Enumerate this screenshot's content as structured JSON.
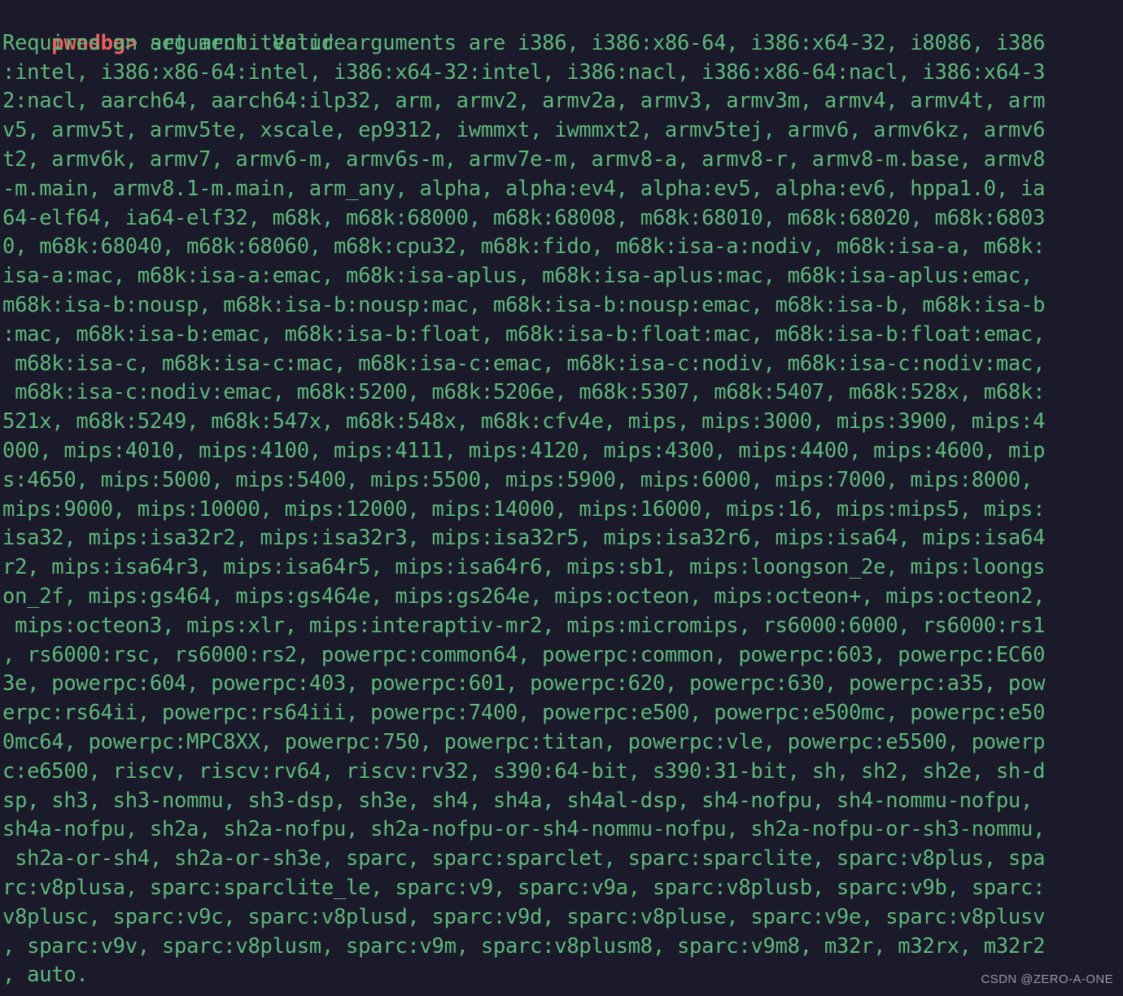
{
  "terminal": {
    "background_color": "#1a1a2b",
    "prompt_color": "#e8615c",
    "output_color": "#5fb87a",
    "prompt": "pwndbg>",
    "command": " set architecture",
    "output_lines": [
      "Requires an argument. Valid arguments are i386, i386:x86-64, i386:x64-32, i8086, i386",
      ":intel, i386:x86-64:intel, i386:x64-32:intel, i386:nacl, i386:x86-64:nacl, i386:x64-3",
      "2:nacl, aarch64, aarch64:ilp32, arm, armv2, armv2a, armv3, armv3m, armv4, armv4t, arm",
      "v5, armv5t, armv5te, xscale, ep9312, iwmmxt, iwmmxt2, armv5tej, armv6, armv6kz, armv6",
      "t2, armv6k, armv7, armv6-m, armv6s-m, armv7e-m, armv8-a, armv8-r, armv8-m.base, armv8",
      "-m.main, armv8.1-m.main, arm_any, alpha, alpha:ev4, alpha:ev5, alpha:ev6, hppa1.0, ia",
      "64-elf64, ia64-elf32, m68k, m68k:68000, m68k:68008, m68k:68010, m68k:68020, m68k:6803",
      "0, m68k:68040, m68k:68060, m68k:cpu32, m68k:fido, m68k:isa-a:nodiv, m68k:isa-a, m68k:",
      "isa-a:mac, m68k:isa-a:emac, m68k:isa-aplus, m68k:isa-aplus:mac, m68k:isa-aplus:emac,",
      "m68k:isa-b:nousp, m68k:isa-b:nousp:mac, m68k:isa-b:nousp:emac, m68k:isa-b, m68k:isa-b",
      ":mac, m68k:isa-b:emac, m68k:isa-b:float, m68k:isa-b:float:mac, m68k:isa-b:float:emac,",
      " m68k:isa-c, m68k:isa-c:mac, m68k:isa-c:emac, m68k:isa-c:nodiv, m68k:isa-c:nodiv:mac,",
      " m68k:isa-c:nodiv:emac, m68k:5200, m68k:5206e, m68k:5307, m68k:5407, m68k:528x, m68k:",
      "521x, m68k:5249, m68k:547x, m68k:548x, m68k:cfv4e, mips, mips:3000, mips:3900, mips:4",
      "000, mips:4010, mips:4100, mips:4111, mips:4120, mips:4300, mips:4400, mips:4600, mip",
      "s:4650, mips:5000, mips:5400, mips:5500, mips:5900, mips:6000, mips:7000, mips:8000,",
      "mips:9000, mips:10000, mips:12000, mips:14000, mips:16000, mips:16, mips:mips5, mips:",
      "isa32, mips:isa32r2, mips:isa32r3, mips:isa32r5, mips:isa32r6, mips:isa64, mips:isa64",
      "r2, mips:isa64r3, mips:isa64r5, mips:isa64r6, mips:sb1, mips:loongson_2e, mips:loongs",
      "on_2f, mips:gs464, mips:gs464e, mips:gs264e, mips:octeon, mips:octeon+, mips:octeon2,",
      " mips:octeon3, mips:xlr, mips:interaptiv-mr2, mips:micromips, rs6000:6000, rs6000:rs1",
      ", rs6000:rsc, rs6000:rs2, powerpc:common64, powerpc:common, powerpc:603, powerpc:EC60",
      "3e, powerpc:604, powerpc:403, powerpc:601, powerpc:620, powerpc:630, powerpc:a35, pow",
      "erpc:rs64ii, powerpc:rs64iii, powerpc:7400, powerpc:e500, powerpc:e500mc, powerpc:e50",
      "0mc64, powerpc:MPC8XX, powerpc:750, powerpc:titan, powerpc:vle, powerpc:e5500, powerp",
      "c:e6500, riscv, riscv:rv64, riscv:rv32, s390:64-bit, s390:31-bit, sh, sh2, sh2e, sh-d",
      "sp, sh3, sh3-nommu, sh3-dsp, sh3e, sh4, sh4a, sh4al-dsp, sh4-nofpu, sh4-nommu-nofpu,",
      "sh4a-nofpu, sh2a, sh2a-nofpu, sh2a-nofpu-or-sh4-nommu-nofpu, sh2a-nofpu-or-sh3-nommu,",
      " sh2a-or-sh4, sh2a-or-sh3e, sparc, sparc:sparclet, sparc:sparclite, sparc:v8plus, spa",
      "rc:v8plusa, sparc:sparclite_le, sparc:v9, sparc:v9a, sparc:v8plusb, sparc:v9b, sparc:",
      "v8plusc, sparc:v9c, sparc:v8plusd, sparc:v9d, sparc:v8pluse, sparc:v9e, sparc:v8plusv",
      ", sparc:v9v, sparc:v8plusm, sparc:v9m, sparc:v8plusm8, sparc:v9m8, m32r, m32rx, m32r2",
      ", auto."
    ]
  },
  "watermark": {
    "text": "CSDN @ZERO-A-ONE"
  }
}
